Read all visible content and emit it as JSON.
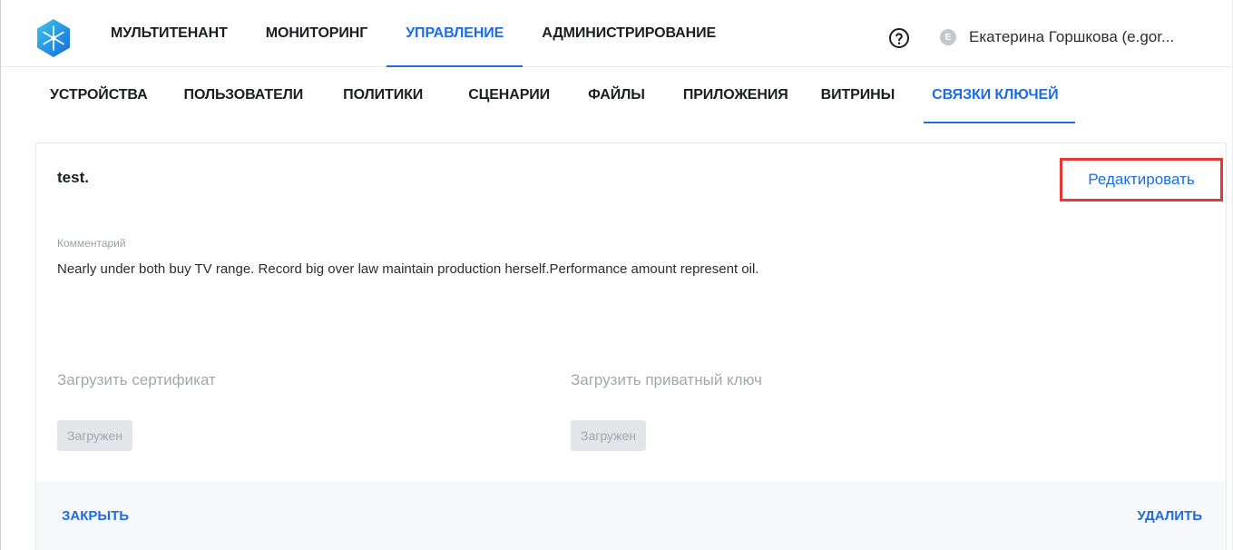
{
  "top_nav": {
    "items": [
      {
        "label": "МУЛЬТИТЕНАНТ",
        "active": false
      },
      {
        "label": "МОНИТОРИНГ",
        "active": false
      },
      {
        "label": "УПРАВЛЕНИЕ",
        "active": true
      },
      {
        "label": "АДМИНИСТРИРОВАНИЕ",
        "active": false
      }
    ],
    "help_icon": "help-circle-icon",
    "user": {
      "avatar_initial": "E",
      "name": "Екатерина Горшкова (e.gor..."
    }
  },
  "sub_nav": {
    "items": [
      {
        "label": "УСТРОЙСТВА",
        "active": false
      },
      {
        "label": "ПОЛЬЗОВАТЕЛИ",
        "active": false
      },
      {
        "label": "ПОЛИТИКИ",
        "active": false
      },
      {
        "label": "СЦЕНАРИИ",
        "active": false
      },
      {
        "label": "ФАЙЛЫ",
        "active": false
      },
      {
        "label": "ПРИЛОЖЕНИЯ",
        "active": false
      },
      {
        "label": "ВИТРИНЫ",
        "active": false
      },
      {
        "label": "СВЯЗКИ КЛЮЧЕЙ",
        "active": true
      }
    ]
  },
  "card": {
    "title": "test.",
    "edit_label": "Редактировать",
    "comment_label": "Комментарий",
    "comment_text": "Nearly under both buy TV range. Record big over law maintain production herself.Performance amount represent oil.",
    "certificate": {
      "label": "Загрузить сертификат",
      "status": "Загружен"
    },
    "private_key": {
      "label": "Загрузить приватный ключ",
      "status": "Загружен"
    },
    "footer": {
      "close_label": "ЗАКРЫТЬ",
      "delete_label": "УДАЛИТЬ"
    }
  },
  "colors": {
    "accent": "#1d6ce0",
    "highlight_border": "#e53935",
    "muted_text": "#a3a7ac"
  }
}
